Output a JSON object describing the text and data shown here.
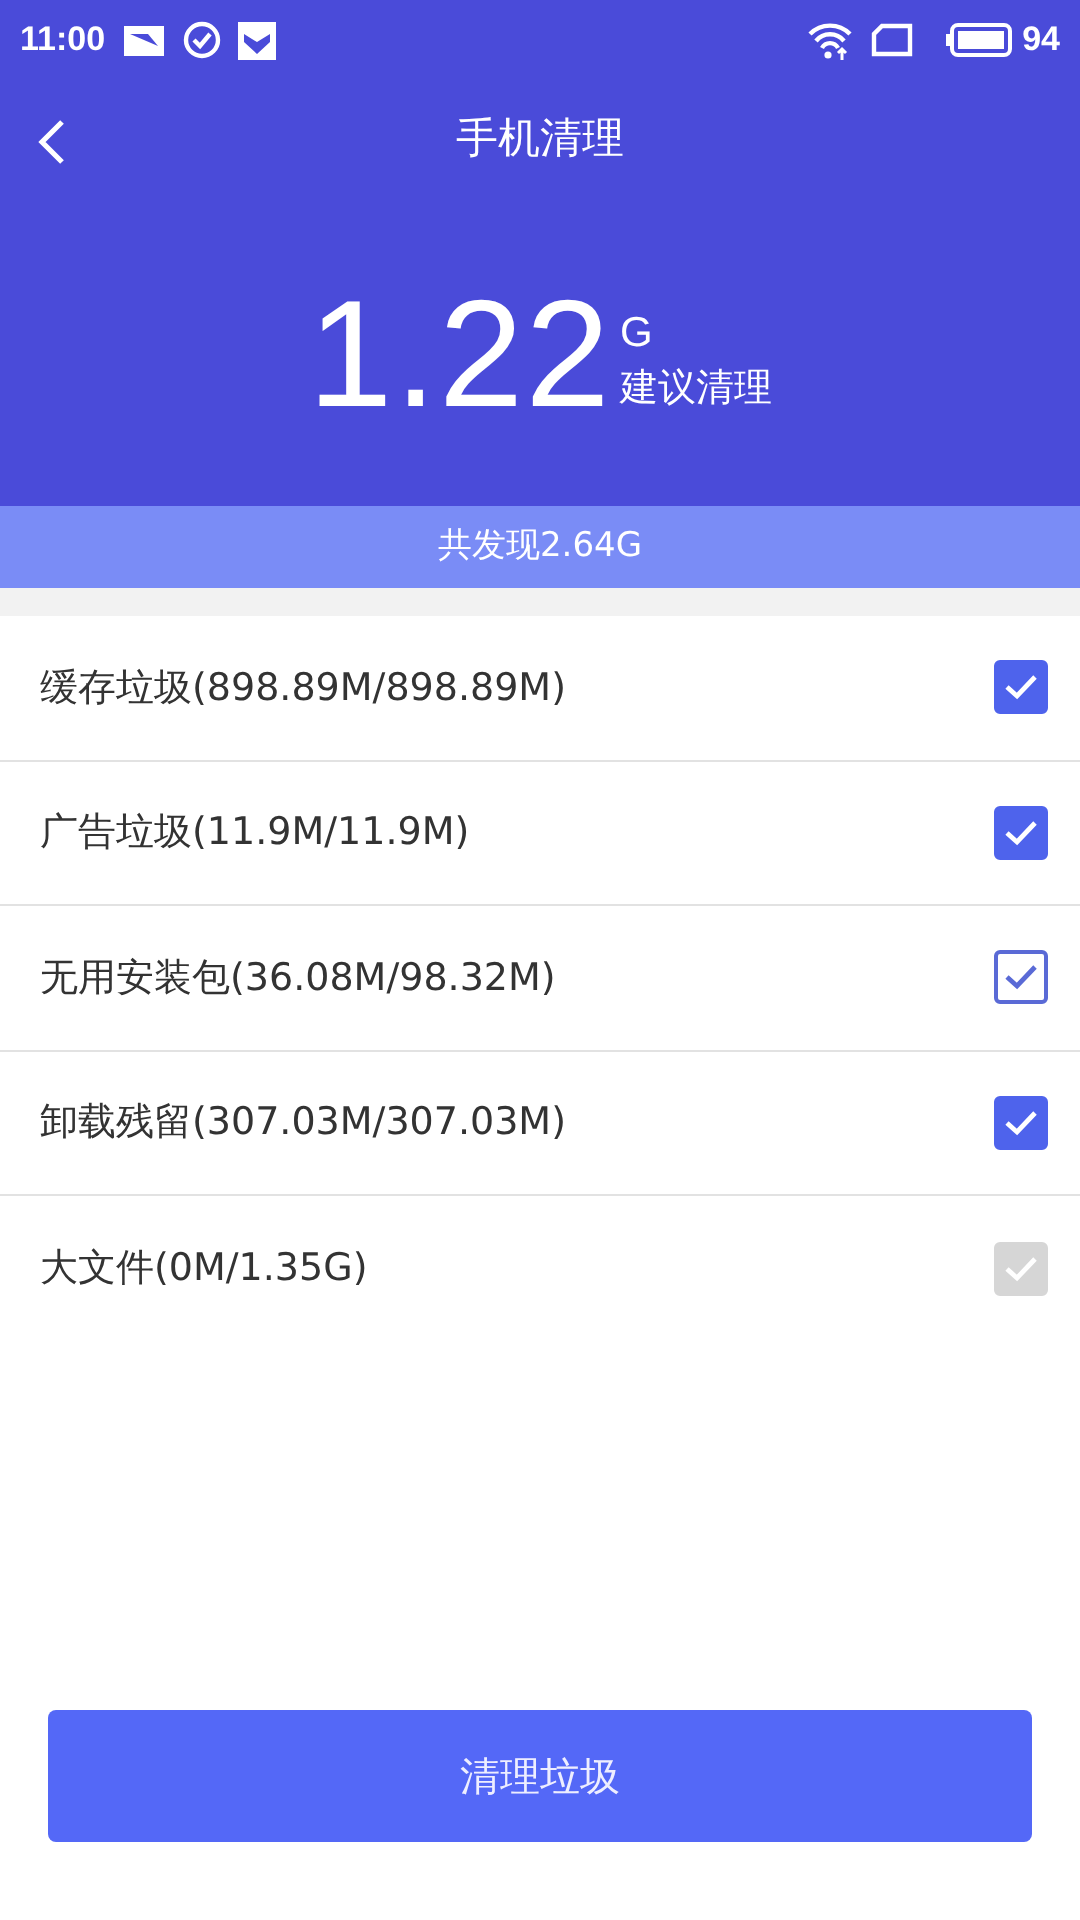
{
  "status_bar": {
    "time": "11:00",
    "battery": "94"
  },
  "header": {
    "title": "手机清理",
    "amount": "1.22",
    "unit": "G",
    "amount_caption": "建议清理"
  },
  "found_banner": "共发现2.64G",
  "items": [
    {
      "label": "缓存垃圾(898.89M/898.89M)",
      "kind": "filled",
      "checked": true
    },
    {
      "label": "广告垃圾(11.9M/11.9M)",
      "kind": "filled",
      "checked": true
    },
    {
      "label": "无用安装包(36.08M/98.32M)",
      "kind": "outlined",
      "checked": true
    },
    {
      "label": "卸载残留(307.03M/307.03M)",
      "kind": "filled",
      "checked": true
    },
    {
      "label": "大文件(0M/1.35G)",
      "kind": "greyed",
      "checked": true
    }
  ],
  "action_button": "清理垃圾"
}
